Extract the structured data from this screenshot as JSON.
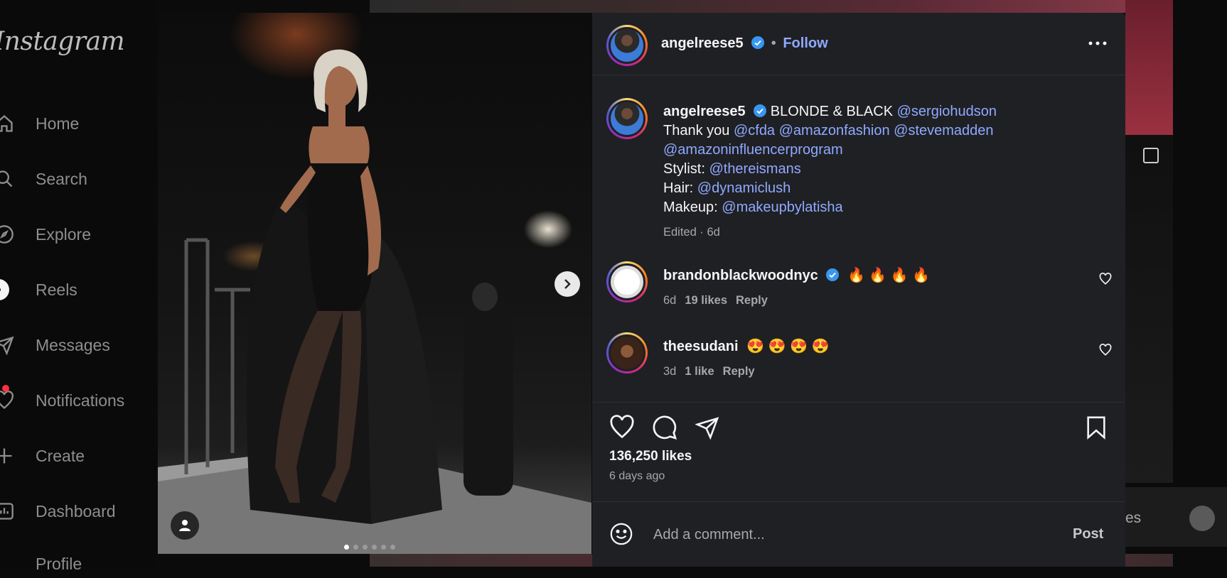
{
  "sidebar": {
    "logo": "Instagram",
    "items": [
      {
        "label": "Home",
        "icon": "home-icon"
      },
      {
        "label": "Search",
        "icon": "search-icon"
      },
      {
        "label": "Explore",
        "icon": "explore-icon"
      },
      {
        "label": "Reels",
        "icon": "reels-icon"
      },
      {
        "label": "Messages",
        "icon": "messages-icon"
      },
      {
        "label": "Notifications",
        "icon": "heart-icon"
      },
      {
        "label": "Create",
        "icon": "plus-icon"
      },
      {
        "label": "Dashboard",
        "icon": "dashboard-icon"
      },
      {
        "label": "Profile",
        "icon": "profile-icon"
      }
    ]
  },
  "post": {
    "carousel": {
      "slides": 6,
      "active_index": 0
    },
    "author": "angelreese5",
    "follow_label": "Follow",
    "separator": "•",
    "caption": {
      "username": "angelreese5",
      "text1": "BLONDE & BLACK ",
      "mention1": "@sergiohudson",
      "thanks": "Thank you ",
      "mentions_line": [
        "@cfda",
        "@amazonfashion",
        "@stevemadden"
      ],
      "mention_line3": "@amazoninfluencerprogram",
      "stylist_label": "Stylist: ",
      "stylist": "@thereismans",
      "hair_label": "Hair: ",
      "hair": "@dynamiclush",
      "makeup_label": "Makeup: ",
      "makeup": "@makeupbylatisha",
      "meta": "Edited · 6d"
    },
    "comments": [
      {
        "username": "brandonblackwoodnyc",
        "verified": true,
        "text": "🔥 🔥 🔥 🔥",
        "age": "6d",
        "likes": "19 likes",
        "reply": "Reply"
      },
      {
        "username": "theesudani",
        "verified": false,
        "text": "😍 😍 😍 😍",
        "age": "3d",
        "likes": "1 like",
        "reply": "Reply"
      }
    ],
    "likes": "136,250 likes",
    "time_ago": "6 days ago",
    "comment_placeholder": "Add a comment...",
    "post_label": "Post"
  },
  "background_partial_text": "es",
  "colors": {
    "accent_link": "#8fa9ff",
    "verified": "#3897f0",
    "panel_bg": "#1f2024"
  }
}
